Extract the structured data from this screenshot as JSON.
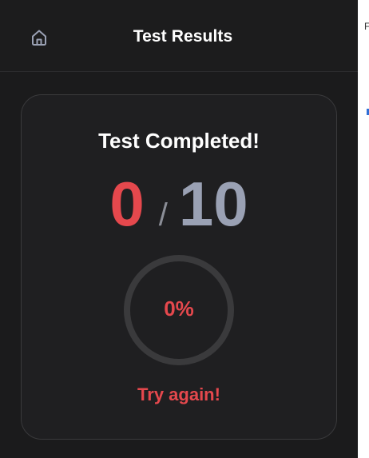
{
  "header": {
    "title": "Test Results",
    "home_icon": "home-icon"
  },
  "result_card": {
    "title": "Test Completed!",
    "score": "0",
    "separator": "/",
    "total": "10",
    "percent": "0%",
    "progress": 0,
    "message": "Try again!"
  },
  "edge": {
    "mark": "F"
  },
  "colors": {
    "background": "#1b1b1c",
    "card_background": "#1f1f21",
    "card_border": "#3a3a3c",
    "score_red": "#e5484d",
    "total_gray": "#9aa1b4",
    "ring_track": "#3a3a3c"
  }
}
